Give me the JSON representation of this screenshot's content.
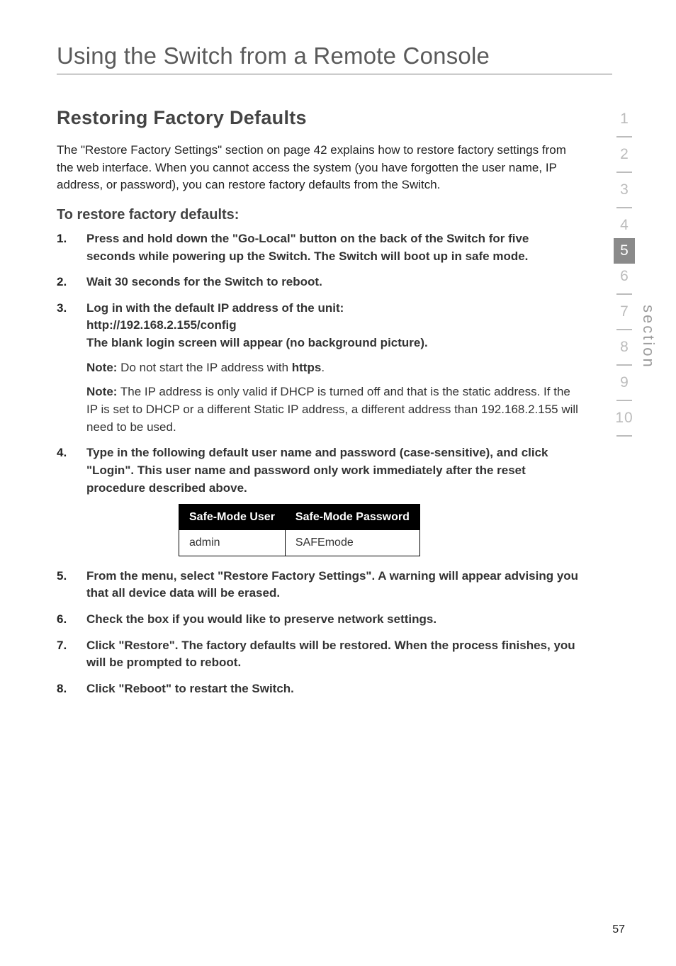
{
  "chapter_title": "Using the Switch from a Remote Console",
  "section_heading": "Restoring Factory Defaults",
  "intro": "The \"Restore Factory Settings\" section on page 42 explains how to restore factory settings from the web interface. When you cannot access the system (you have forgotten the user name, IP address, or password), you can restore factory defaults from the Switch.",
  "subheading": "To restore factory defaults:",
  "steps": {
    "s1": "Press and hold down the \"Go-Local\" button on the back of the Switch for five seconds while powering up the Switch. The Switch will boot up in safe mode.",
    "s2": "Wait 30 seconds for the Switch to reboot.",
    "s3_a": "Log in with the default IP address of the unit:",
    "s3_url": "http://192.168.2.155/config",
    "s3_b": "The blank login screen will appear (no background picture).",
    "s3_note1_label": "Note:",
    "s3_note1_text": " Do not start the IP address with ",
    "s3_note1_bold": "https",
    "s3_note1_end": ".",
    "s3_note2_label": "Note:",
    "s3_note2_text": " The IP address is only valid if DHCP is turned off and that is the static address. If the IP is set to DHCP or a different Static IP address, a different address than 192.168.2.155 will need to be used.",
    "s4": "Type in the following default user name and password (case-sensitive), and click \"Login\". This user name and password only work immediately after the reset procedure described above.",
    "s5": "From the menu, select \"Restore Factory Settings\". A warning will appear advising you that all device data will be erased.",
    "s6": "Check the box if you would like to preserve network settings.",
    "s7": "Click \"Restore\". The factory defaults will be restored. When the process finishes, you will be prompted to reboot.",
    "s8": "Click \"Reboot\" to restart the Switch."
  },
  "cred_table": {
    "h1": "Safe-Mode User",
    "h2": "Safe-Mode Password",
    "r1c1": "admin",
    "r1c2": "SAFEmode"
  },
  "side_tabs": [
    "1",
    "2",
    "3",
    "4",
    "5",
    "6",
    "7",
    "8",
    "9",
    "10"
  ],
  "active_tab_index": 4,
  "side_label": "section",
  "page_number": "57"
}
